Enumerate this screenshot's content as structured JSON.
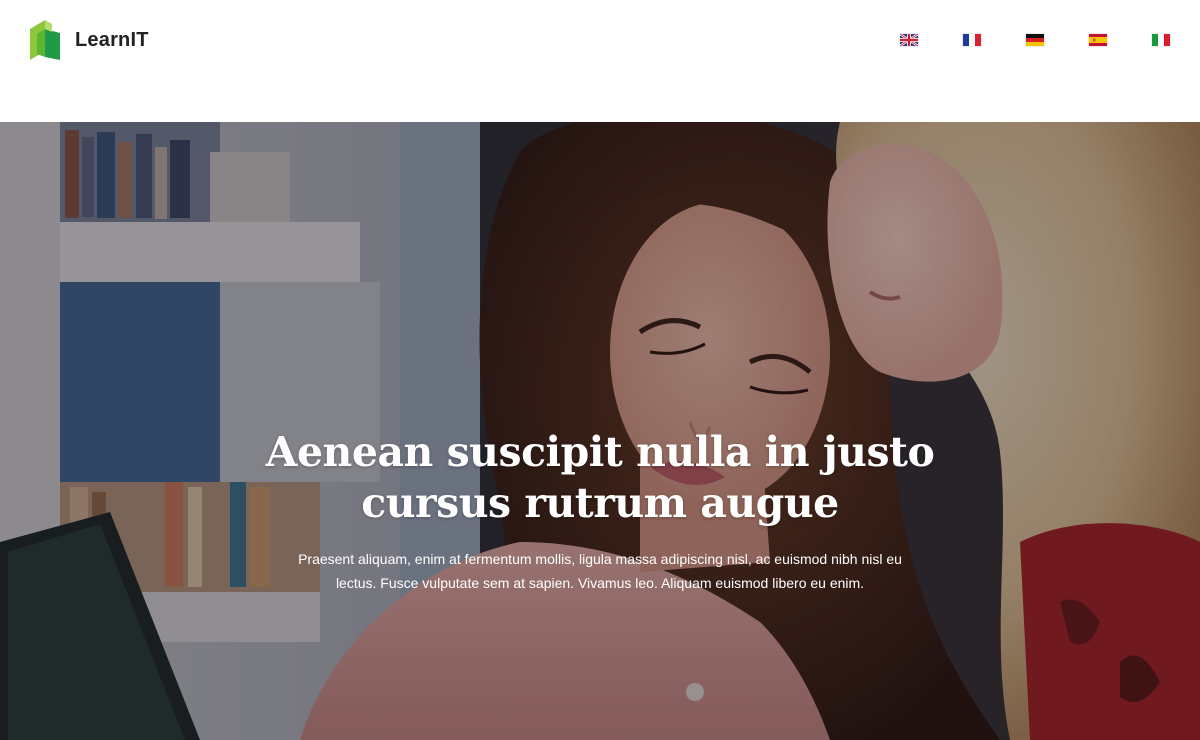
{
  "header": {
    "brand_name": "LearnIT",
    "logo_icon": "book-logo-icon",
    "brand_colors": {
      "logo_light_green": "#8dc63f",
      "logo_dark_green": "#1f9a48"
    },
    "languages": [
      {
        "code": "en",
        "icon": "flag-uk-icon"
      },
      {
        "code": "fr",
        "icon": "flag-france-icon"
      },
      {
        "code": "de",
        "icon": "flag-germany-icon"
      },
      {
        "code": "es",
        "icon": "flag-spain-icon"
      },
      {
        "code": "it",
        "icon": "flag-italy-icon"
      }
    ]
  },
  "hero": {
    "title": "Aenean suscipit nulla in justo cursus rutrum augue",
    "text": "Praesent aliquam, enim at fermentum mollis, ligula massa adipiscing nisl, ac euismod nibh nisl eu lectus. Fusce vulputate sem at sapien. Vivamus leo. Aliquam euismod libero eu enim.",
    "image_icon": "students-photo"
  }
}
